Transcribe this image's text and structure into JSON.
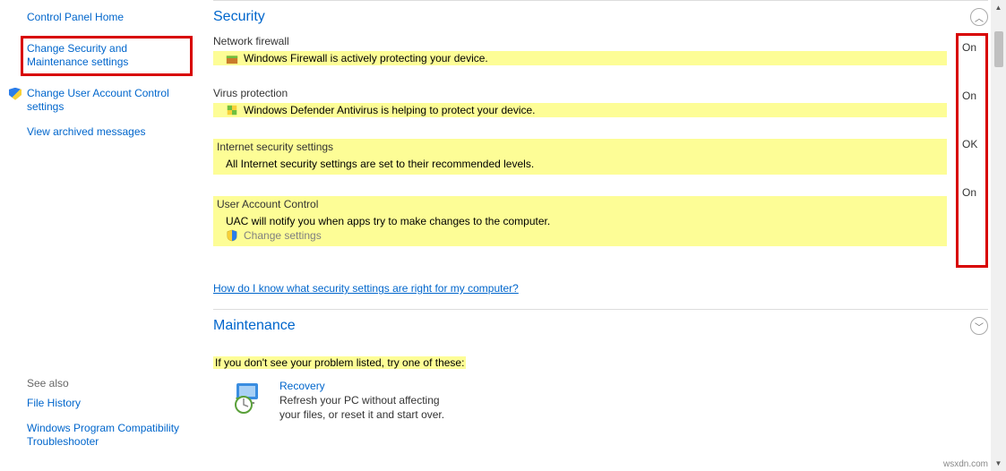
{
  "sidebar": {
    "home": "Control Panel Home",
    "change_security": "Change Security and Maintenance settings",
    "change_uac": "Change User Account Control settings",
    "view_archived": "View archived messages",
    "see_also_label": "See also",
    "file_history": "File History",
    "wp_trouble": "Windows Program Compatibility Troubleshooter"
  },
  "security": {
    "title": "Security",
    "network_firewall": {
      "label": "Network firewall",
      "desc": "Windows Firewall is actively protecting your device.",
      "status": "On"
    },
    "virus": {
      "label": "Virus protection",
      "desc": "Windows Defender Antivirus is helping to protect your device.",
      "status": "On"
    },
    "internet": {
      "label": "Internet security settings",
      "desc": "All Internet security settings are set to their recommended levels.",
      "status": "OK"
    },
    "uac": {
      "label": "User Account Control",
      "desc": "UAC will notify you when apps try to make changes to the computer.",
      "change": "Change settings",
      "status": "On"
    },
    "question": "How do I know what security settings are right for my computer?"
  },
  "maintenance": {
    "title": "Maintenance"
  },
  "bottom": {
    "hint": "If you don't see your problem listed, try one of these:",
    "recovery_title": "Recovery",
    "recovery_desc": "Refresh your PC without affecting your files, or reset it and start over."
  },
  "watermark": "wsxdn.com"
}
